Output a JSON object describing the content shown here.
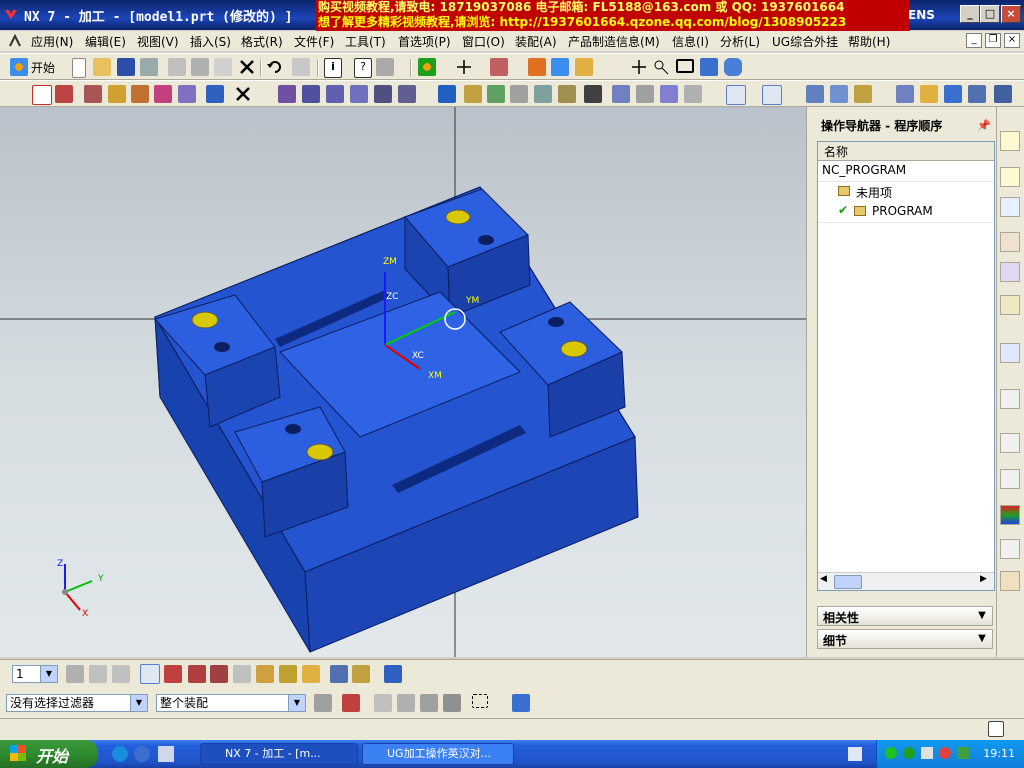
{
  "titlebar": {
    "app_title": "NX 7 - 加工 - [model1.prt (修改的) ]",
    "ad_line1": "购买视频教程,请致电: 18719037086 电子邮箱: FL5188@163.com 或 QQ: 1937601664",
    "ad_line2": "想了解更多精彩视频教程,请浏览: http://1937601664.qzone.qq.com/blog/1308905223",
    "brand_tail": "ENS",
    "minimize": "_",
    "maximize": "□",
    "close": "×"
  },
  "menubar": {
    "items": [
      "应用(N)",
      "编辑(E)",
      "视图(V)",
      "插入(S)",
      "格式(R)",
      "文件(F)",
      "工具(T)",
      "首选项(P)",
      "窗口(O)",
      "装配(A)",
      "产品制造信息(M)",
      "信息(I)",
      "分析(L)",
      "UG综合外挂",
      "帮助(H)"
    ]
  },
  "toolbar1": {
    "start_label": "开始"
  },
  "viewport": {
    "labels": {
      "zm": "ZM",
      "zc": "ZC",
      "ym": "YM",
      "xc": "XC",
      "xm": "XM"
    },
    "triad": {
      "z": "Z",
      "y": "Y",
      "x": "X"
    }
  },
  "navigator": {
    "title": "操作导航器 - 程序顺序",
    "column_name": "名称",
    "rows": [
      {
        "label": "NC_PROGRAM"
      },
      {
        "label": "未用项"
      },
      {
        "label": "PROGRAM"
      }
    ],
    "sections": {
      "relations": "相关性",
      "details": "细节"
    }
  },
  "bottom": {
    "layer_value": "1",
    "filter_value": "没有选择过滤器",
    "assembly_value": "整个装配"
  },
  "taskbar": {
    "start": "开始",
    "tasks": [
      "NX 7 - 加工 - [m...",
      "UG加工操作英汉对..."
    ],
    "clock": "19:11"
  },
  "colors": {
    "part": "#1f4fc8",
    "hole": "#d8c800",
    "title_ad": "#c00000",
    "taskbar": "#245edb"
  }
}
